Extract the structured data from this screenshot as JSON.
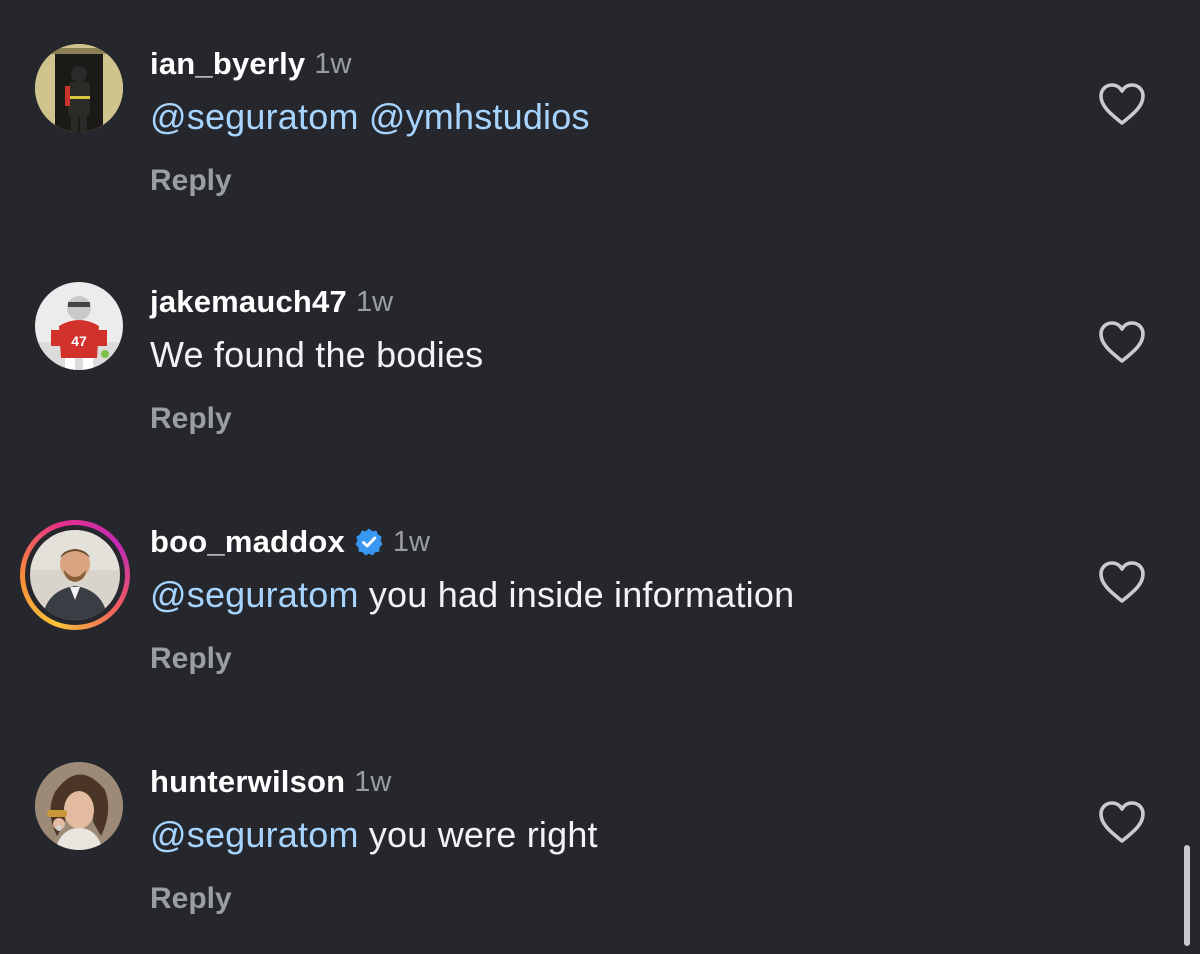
{
  "comments": [
    {
      "username": "ian_byerly",
      "time": "1w",
      "mentions": [
        "@seguratom",
        "@ymhstudios"
      ],
      "text": "",
      "verified": false,
      "reply_label": "Reply",
      "avatar_icon": "avatar-photo-firefighter"
    },
    {
      "username": "jakemauch47",
      "time": "1w",
      "mentions": [],
      "text": "We found the bodies",
      "verified": false,
      "reply_label": "Reply",
      "avatar_icon": "avatar-photo-football-player"
    },
    {
      "username": "boo_maddox",
      "time": "1w",
      "mentions": [
        "@seguratom"
      ],
      "text": "you had inside information",
      "verified": true,
      "reply_label": "Reply",
      "avatar_icon": "avatar-photo-man-suit",
      "story_ring": true
    },
    {
      "username": "hunterwilson",
      "time": "1w",
      "mentions": [
        "@seguratom"
      ],
      "text": "you were right",
      "verified": false,
      "reply_label": "Reply",
      "avatar_icon": "avatar-photo-man-eating"
    }
  ],
  "icons": {
    "like": "heart-outline-icon",
    "verified": "verified-badge-icon"
  },
  "colors": {
    "background": "#25272c",
    "username": "#ffffff",
    "mention": "#a6d4ff",
    "muted": "#9a9da3",
    "verified": "#3897f0"
  }
}
